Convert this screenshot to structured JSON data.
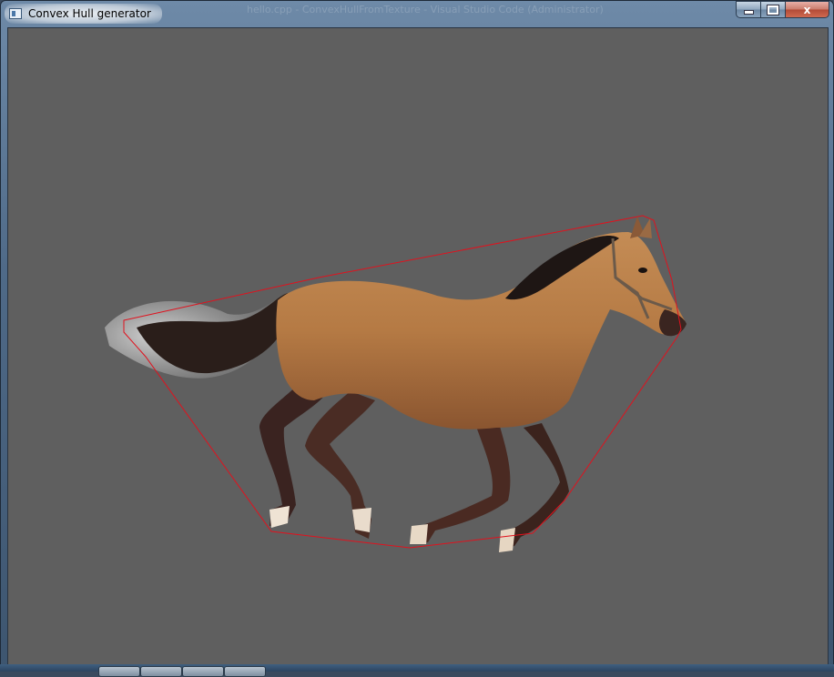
{
  "window": {
    "title": "Convex Hull generator",
    "background_title": "hello.cpp - ConvexHullFromTexture - Visual Studio Code (Administrator)",
    "controls": {
      "minimize": "minimize",
      "maximize": "maximize",
      "close": "x"
    }
  },
  "canvas": {
    "background_color": "#5f5f5f",
    "hull_color": "#e0121e",
    "subject": "horse"
  },
  "icons": {
    "app": "window-app-icon",
    "minimize": "minimize-icon",
    "maximize": "maximize-icon",
    "close": "close-icon"
  }
}
